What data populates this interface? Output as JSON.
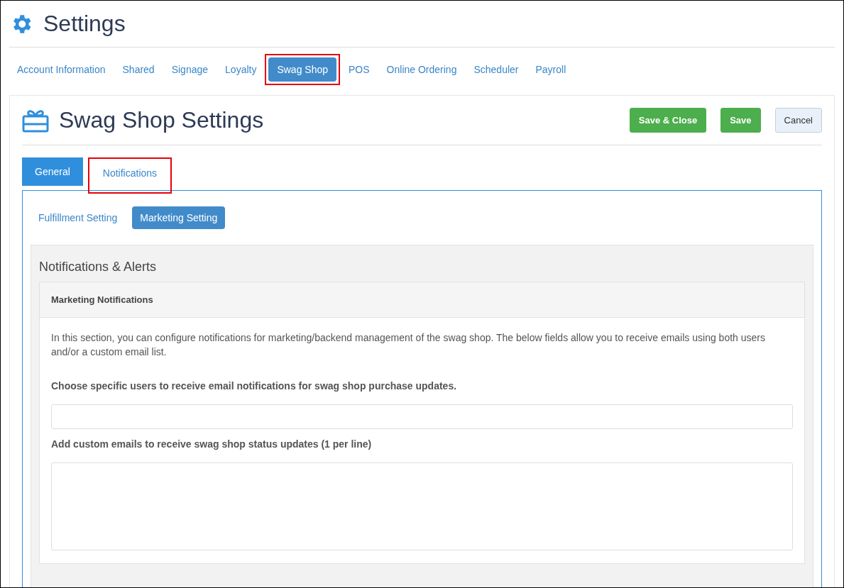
{
  "page": {
    "title": "Settings"
  },
  "nav_tabs": [
    {
      "label": "Account Information",
      "selected": false,
      "highlighted": false
    },
    {
      "label": "Shared",
      "selected": false,
      "highlighted": false
    },
    {
      "label": "Signage",
      "selected": false,
      "highlighted": false
    },
    {
      "label": "Loyalty",
      "selected": false,
      "highlighted": false
    },
    {
      "label": "Swag Shop",
      "selected": true,
      "highlighted": true
    },
    {
      "label": "POS",
      "selected": false,
      "highlighted": false
    },
    {
      "label": "Online Ordering",
      "selected": false,
      "highlighted": false
    },
    {
      "label": "Scheduler",
      "selected": false,
      "highlighted": false
    },
    {
      "label": "Payroll",
      "selected": false,
      "highlighted": false
    }
  ],
  "card": {
    "title": "Swag Shop Settings",
    "buttons": [
      {
        "label": "Save & Close",
        "kind": "primary"
      },
      {
        "label": "Save",
        "kind": "primary"
      },
      {
        "label": "Cancel",
        "kind": "default"
      }
    ],
    "tabs": [
      {
        "label": "General",
        "selected": true,
        "highlighted": false
      },
      {
        "label": "Notifications",
        "selected": false,
        "highlighted": true
      }
    ],
    "sub_tabs": [
      {
        "label": "Fulfillment Setting",
        "selected": false
      },
      {
        "label": "Marketing Setting",
        "selected": true
      }
    ],
    "section": {
      "title": "Notifications & Alerts",
      "panel": {
        "title": "Marketing Notifications",
        "description": "In this section, you can configure notifications for marketing/backend management of the swag shop. The below fields allow you to receive emails using both users and/or a custom email list.",
        "fields": [
          {
            "label": "Choose specific users to receive email notifications for swag shop purchase updates.",
            "kind": "input"
          },
          {
            "label": "Add custom emails to receive swag shop status updates (1 per line)",
            "kind": "textarea"
          }
        ]
      }
    }
  }
}
